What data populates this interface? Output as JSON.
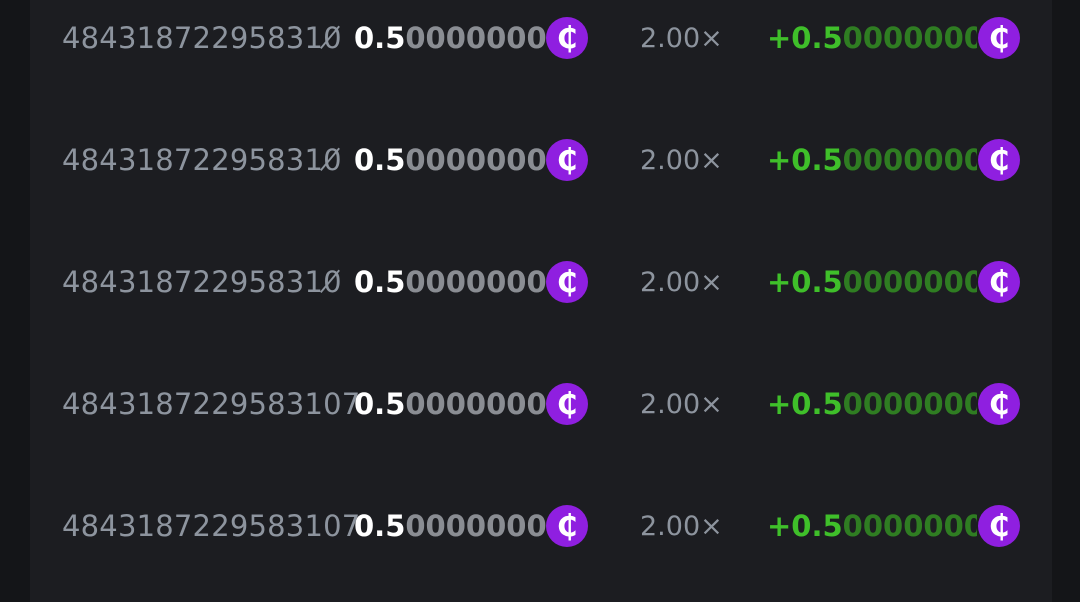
{
  "currency_icon": "cent-coin-icon",
  "colors": {
    "background": "#1c1d21",
    "coin": "#8f1fe0",
    "payout_positive": "#3fbf2a"
  },
  "rows": [
    {
      "bet_id": "484318722958310̸",
      "amount_lead": "0.5",
      "amount_tail": "0000000",
      "multiplier": "2.00×",
      "payout_lead": "+0.5",
      "payout_tail": "0000000",
      "coin": "₵"
    },
    {
      "bet_id": "484318722958310̸",
      "amount_lead": "0.5",
      "amount_tail": "0000000",
      "multiplier": "2.00×",
      "payout_lead": "+0.5",
      "payout_tail": "0000000",
      "coin": "₵"
    },
    {
      "bet_id": "484318722958310̸",
      "amount_lead": "0.5",
      "amount_tail": "0000000",
      "multiplier": "2.00×",
      "payout_lead": "+0.5",
      "payout_tail": "0000000",
      "coin": "₵"
    },
    {
      "bet_id": "4843187229583107",
      "amount_lead": "0.5",
      "amount_tail": "0000000",
      "multiplier": "2.00×",
      "payout_lead": "+0.5",
      "payout_tail": "0000000",
      "coin": "₵"
    },
    {
      "bet_id": "4843187229583107",
      "amount_lead": "0.5",
      "amount_tail": "0000000",
      "multiplier": "2.00×",
      "payout_lead": "+0.5",
      "payout_tail": "0000000",
      "coin": "₵"
    }
  ]
}
